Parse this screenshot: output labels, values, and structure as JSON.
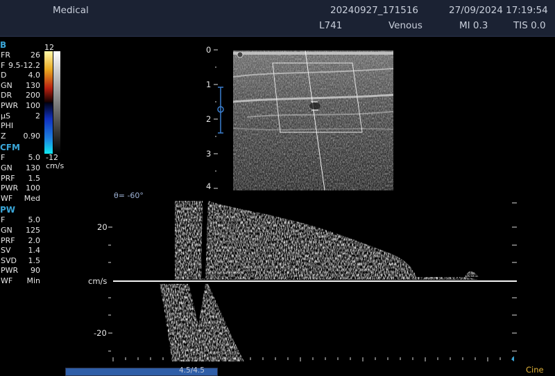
{
  "header": {
    "app": "Medical",
    "study_id": "20240927_171516",
    "datetime": "27/09/2024 17:19:54",
    "probe": "L741",
    "preset": "Venous",
    "mi": "MI 0.3",
    "tis": "TIS 0.0"
  },
  "panels": {
    "b": {
      "title": "B",
      "rows": [
        {
          "k": "FR",
          "v": "26"
        },
        {
          "k": "F",
          "v": "9.5-12.2"
        },
        {
          "k": "D",
          "v": "4.0"
        },
        {
          "k": "GN",
          "v": "130"
        },
        {
          "k": "DR",
          "v": "200"
        },
        {
          "k": "PWR",
          "v": "100"
        },
        {
          "k": "µS",
          "v": "2"
        },
        {
          "k": "PHI",
          "v": ""
        },
        {
          "k": "Z",
          "v": "0.90"
        }
      ]
    },
    "cfm": {
      "title": "CFM",
      "rows": [
        {
          "k": "F",
          "v": "5.0"
        },
        {
          "k": "GN",
          "v": "130"
        },
        {
          "k": "PRF",
          "v": "1.5"
        },
        {
          "k": "PWR",
          "v": "100"
        },
        {
          "k": "WF",
          "v": "Med"
        }
      ]
    },
    "pw": {
      "title": "PW",
      "rows": [
        {
          "k": "F",
          "v": "5.0"
        },
        {
          "k": "GN",
          "v": "125"
        },
        {
          "k": "PRF",
          "v": "2.0"
        },
        {
          "k": "SV",
          "v": "1.4"
        },
        {
          "k": "SVD",
          "v": "1.5"
        },
        {
          "k": "PWR",
          "v": "90"
        },
        {
          "k": "WF",
          "v": "Min"
        }
      ]
    }
  },
  "colorbar": {
    "top": "12",
    "bottom": "-12",
    "unit": "cm/s"
  },
  "depth_scale": [
    "0",
    "1",
    "2",
    "3",
    "4"
  ],
  "doppler": {
    "angle": "θ= -60°",
    "unit": "cm/s",
    "y_pos": "20",
    "y_neg": "-20"
  },
  "cine": {
    "label": "Cine",
    "position": "4.5/4.5",
    "fill_fraction": 1.0
  },
  "colors": {
    "topbar": "#1b2233",
    "accent": "#3aa6d8",
    "cine": "#e0b23a"
  }
}
